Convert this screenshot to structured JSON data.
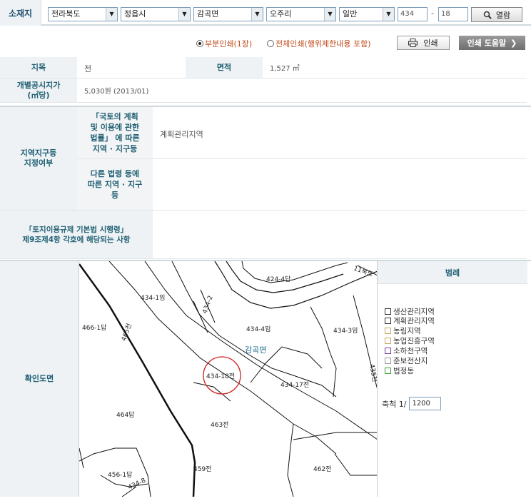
{
  "location": {
    "label": "소재지",
    "province": "전라북도",
    "city": "정읍시",
    "district": "감곡면",
    "village": "오주리",
    "land_type": "일반",
    "main_number": "434",
    "separator": "-",
    "sub_number": "18",
    "view_button": "열람"
  },
  "print": {
    "partial": "부분인쇄(1장)",
    "full": "전체인쇄(행위제한내용 포함)",
    "print_button": "인쇄",
    "help_button": "인쇄 도움말"
  },
  "info": {
    "jimok_label": "지목",
    "jimok_value": "전",
    "area_label": "면적",
    "area_value": "1,527 ㎡",
    "price_label_1": "개별공시지가",
    "price_label_2": "(㎡당)",
    "price_value": "5,030원 (2013/01)"
  },
  "zone": {
    "label_1": "지역지구등",
    "label_2": "지정여부",
    "sub1_lines": [
      "「국토의 계획",
      "및 이용에 관한",
      "법률」 에 따른",
      "지역 · 지구등"
    ],
    "sub1_value": "계획관리지역",
    "sub2_lines": [
      "다른 법령 등에",
      "따른 지역 · 지구",
      "등"
    ],
    "sub2_value": ""
  },
  "regulation": {
    "line1": "「토지이용규제 기본법 시행령」",
    "line2": "제9조제4항 각호에 해당되는 사항",
    "value": ""
  },
  "map_section": {
    "label": "확인도면",
    "labels": {
      "p4244": "424-4답",
      "p4341": "434-1임",
      "p4662": "466-1답",
      "p4342": "434-2",
      "p4344": "434-4임",
      "p4343": "434-3임",
      "p465": "465전",
      "town": "감곡면",
      "p43418": "434-18전",
      "p43417": "434-17전",
      "p435": "435전",
      "p464": "464답",
      "p463": "463전",
      "p462": "462전",
      "p459": "459전",
      "p4561": "456-1답",
      "p4146": "11북도",
      "p4348": "434-8"
    }
  },
  "legend": {
    "title": "범례",
    "items": [
      {
        "label": "생산관리지역",
        "color": "#333333"
      },
      {
        "label": "계획관리지역",
        "color": "#333333"
      },
      {
        "label": "농림지역",
        "color": "#c8a860"
      },
      {
        "label": "농업진흥구역",
        "color": "#c8a860"
      },
      {
        "label": "소하천구역",
        "color": "#7b3fa0"
      },
      {
        "label": "준보전산지",
        "color": "#9a9a9a"
      },
      {
        "label": "법정동",
        "color": "#3aa03a"
      }
    ],
    "scale_label": "축척 1/",
    "scale_value": "1200"
  }
}
